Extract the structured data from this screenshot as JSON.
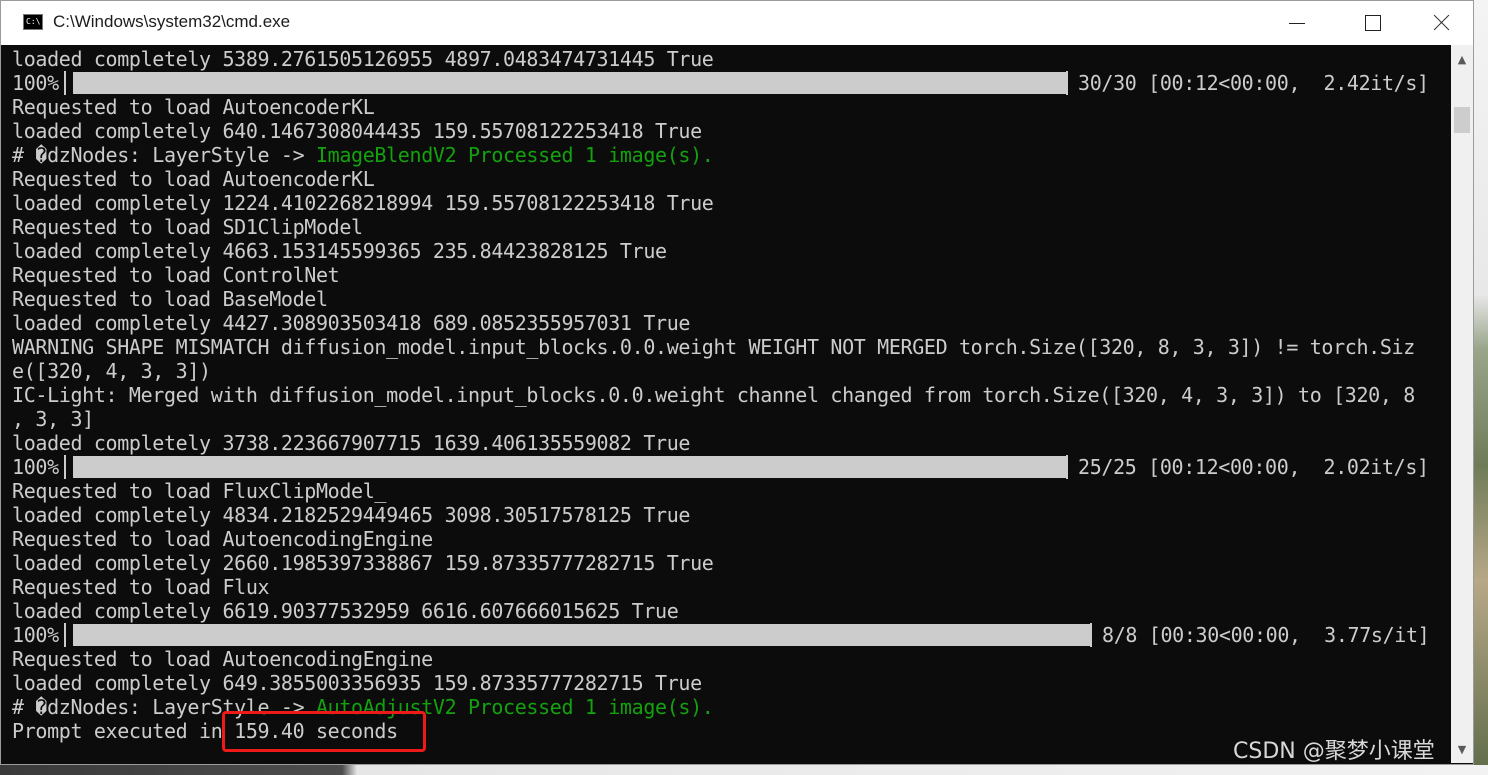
{
  "window": {
    "title": "C:\\Windows\\system32\\cmd.exe",
    "icon_text": "C:\\"
  },
  "console": {
    "lines": [
      {
        "text": "loaded completely 5389.2761505126955 4897.0483474731445 True"
      },
      {
        "progress": {
          "percent": "100%",
          "fraction": 1.0,
          "stats": "30/30 [00:12<00:00,  2.42it/s]"
        }
      },
      {
        "text": "Requested to load AutoencoderKL"
      },
      {
        "text": "loaded completely 640.1467308044435 159.55708122253418 True"
      },
      {
        "text": "# �dzNodes: LayerStyle -> ",
        "green": "ImageBlendV2 Processed 1 image(s)."
      },
      {
        "text": "Requested to load AutoencoderKL"
      },
      {
        "text": "loaded completely 1224.4102268218994 159.55708122253418 True"
      },
      {
        "text": "Requested to load SD1ClipModel"
      },
      {
        "text": "loaded completely 4663.153145599365 235.84423828125 True"
      },
      {
        "text": "Requested to load ControlNet"
      },
      {
        "text": "Requested to load BaseModel"
      },
      {
        "text": "loaded completely 4427.308903503418 689.0852355957031 True"
      },
      {
        "text": "WARNING SHAPE MISMATCH diffusion_model.input_blocks.0.0.weight WEIGHT NOT MERGED torch.Size([320, 8, 3, 3]) != torch.Siz"
      },
      {
        "text": "e([320, 4, 3, 3])"
      },
      {
        "text": "IC-Light: Merged with diffusion_model.input_blocks.0.0.weight channel changed from torch.Size([320, 4, 3, 3]) to [320, 8"
      },
      {
        "text": ", 3, 3]"
      },
      {
        "text": "loaded completely 3738.223667907715 1639.406135559082 True"
      },
      {
        "progress": {
          "percent": "100%",
          "fraction": 1.0,
          "stats": "25/25 [00:12<00:00,  2.02it/s]"
        }
      },
      {
        "text": "Requested to load FluxClipModel_"
      },
      {
        "text": "loaded completely 4834.2182529449465 3098.30517578125 True"
      },
      {
        "text": "Requested to load AutoencodingEngine"
      },
      {
        "text": "loaded completely 2660.1985397338867 159.87335777282715 True"
      },
      {
        "text": "Requested to load Flux"
      },
      {
        "text": "loaded completely 6619.90377532959 6616.607666015625 True"
      },
      {
        "progress": {
          "percent": "100%",
          "fraction": 1.0,
          "stats": "8/8 [00:30<00:00,  3.77s/it]",
          "wide": true
        }
      },
      {
        "text": "Requested to load AutoencodingEngine"
      },
      {
        "text": "loaded completely 649.3855003356935 159.87335777282715 True"
      },
      {
        "text": "# �dzNodes: LayerStyle -> ",
        "green": "AutoAdjustV2 Processed 1 image(s)."
      },
      {
        "text": "Prompt executed in 159.40 seconds"
      }
    ]
  },
  "watermark": "CSDN @聚梦小课堂",
  "colors": {
    "console_bg": "#0c0c0c",
    "console_text": "#cccccc",
    "green_text": "#13a10e",
    "highlight": "#ee1a1a"
  },
  "icons": [
    "console-app-icon",
    "minimize-icon",
    "maximize-icon",
    "close-icon",
    "scroll-up-icon",
    "scroll-down-icon"
  ]
}
